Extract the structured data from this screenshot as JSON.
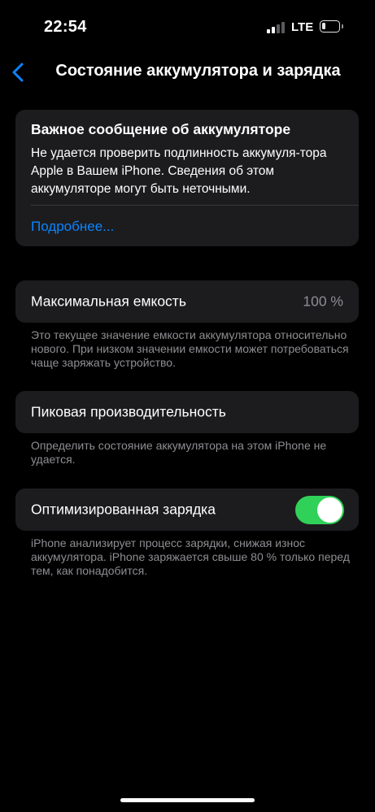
{
  "status_bar": {
    "time": "22:54",
    "network": "LTE",
    "signal_bars_active": 2,
    "signal_bars_total": 4,
    "battery_level": 0.15
  },
  "nav": {
    "back_icon": "chevron-left-icon",
    "title": "Состояние аккумулятора и зарядка"
  },
  "battery_message": {
    "title": "Важное сообщение об аккумуляторе",
    "text": "Не удается проверить подлинность аккумуля-тора Apple в Вашем iPhone. Сведения об этом аккумуляторе могут быть неточными.",
    "link": "Подробнее..."
  },
  "max_capacity": {
    "label": "Максимальная емкость",
    "value": "100 %",
    "footnote": "Это текущее значение емкости аккумулятора относительно нового. При низком значении емкости может потребоваться чаще заряжать устройство."
  },
  "peak_performance": {
    "label": "Пиковая производительность",
    "footnote": "Определить состояние аккумулятора на этом iPhone не удается."
  },
  "optimized_charging": {
    "label": "Оптимизированная зарядка",
    "enabled": true,
    "footnote": "iPhone анализирует процесс зарядки, снижая износ аккумулятора. iPhone заряжается свыше 80 % только перед тем, как понадобится."
  },
  "colors": {
    "background": "#000000",
    "card": "#1c1c1e",
    "accent_link": "#0a84ff",
    "toggle_on": "#30d158",
    "secondary_text": "#8e8e93"
  }
}
